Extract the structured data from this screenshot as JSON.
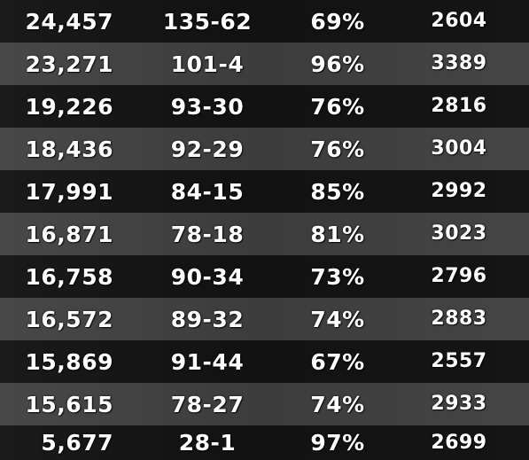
{
  "rows": [
    {
      "score": "24,457",
      "record": "135-62",
      "pct": "69%",
      "rating": "2604"
    },
    {
      "score": "23,271",
      "record": "101-4",
      "pct": "96%",
      "rating": "3389"
    },
    {
      "score": "19,226",
      "record": "93-30",
      "pct": "76%",
      "rating": "2816"
    },
    {
      "score": "18,436",
      "record": "92-29",
      "pct": "76%",
      "rating": "3004"
    },
    {
      "score": "17,991",
      "record": "84-15",
      "pct": "85%",
      "rating": "2992"
    },
    {
      "score": "16,871",
      "record": "78-18",
      "pct": "81%",
      "rating": "3023"
    },
    {
      "score": "16,758",
      "record": "90-34",
      "pct": "73%",
      "rating": "2796"
    },
    {
      "score": "16,572",
      "record": "89-32",
      "pct": "74%",
      "rating": "2883"
    },
    {
      "score": "15,869",
      "record": "91-44",
      "pct": "67%",
      "rating": "2557"
    },
    {
      "score": "15,615",
      "record": "78-27",
      "pct": "74%",
      "rating": "2933"
    },
    {
      "score": "5,677",
      "record": "28-1",
      "pct": "97%",
      "rating": "2699"
    }
  ]
}
